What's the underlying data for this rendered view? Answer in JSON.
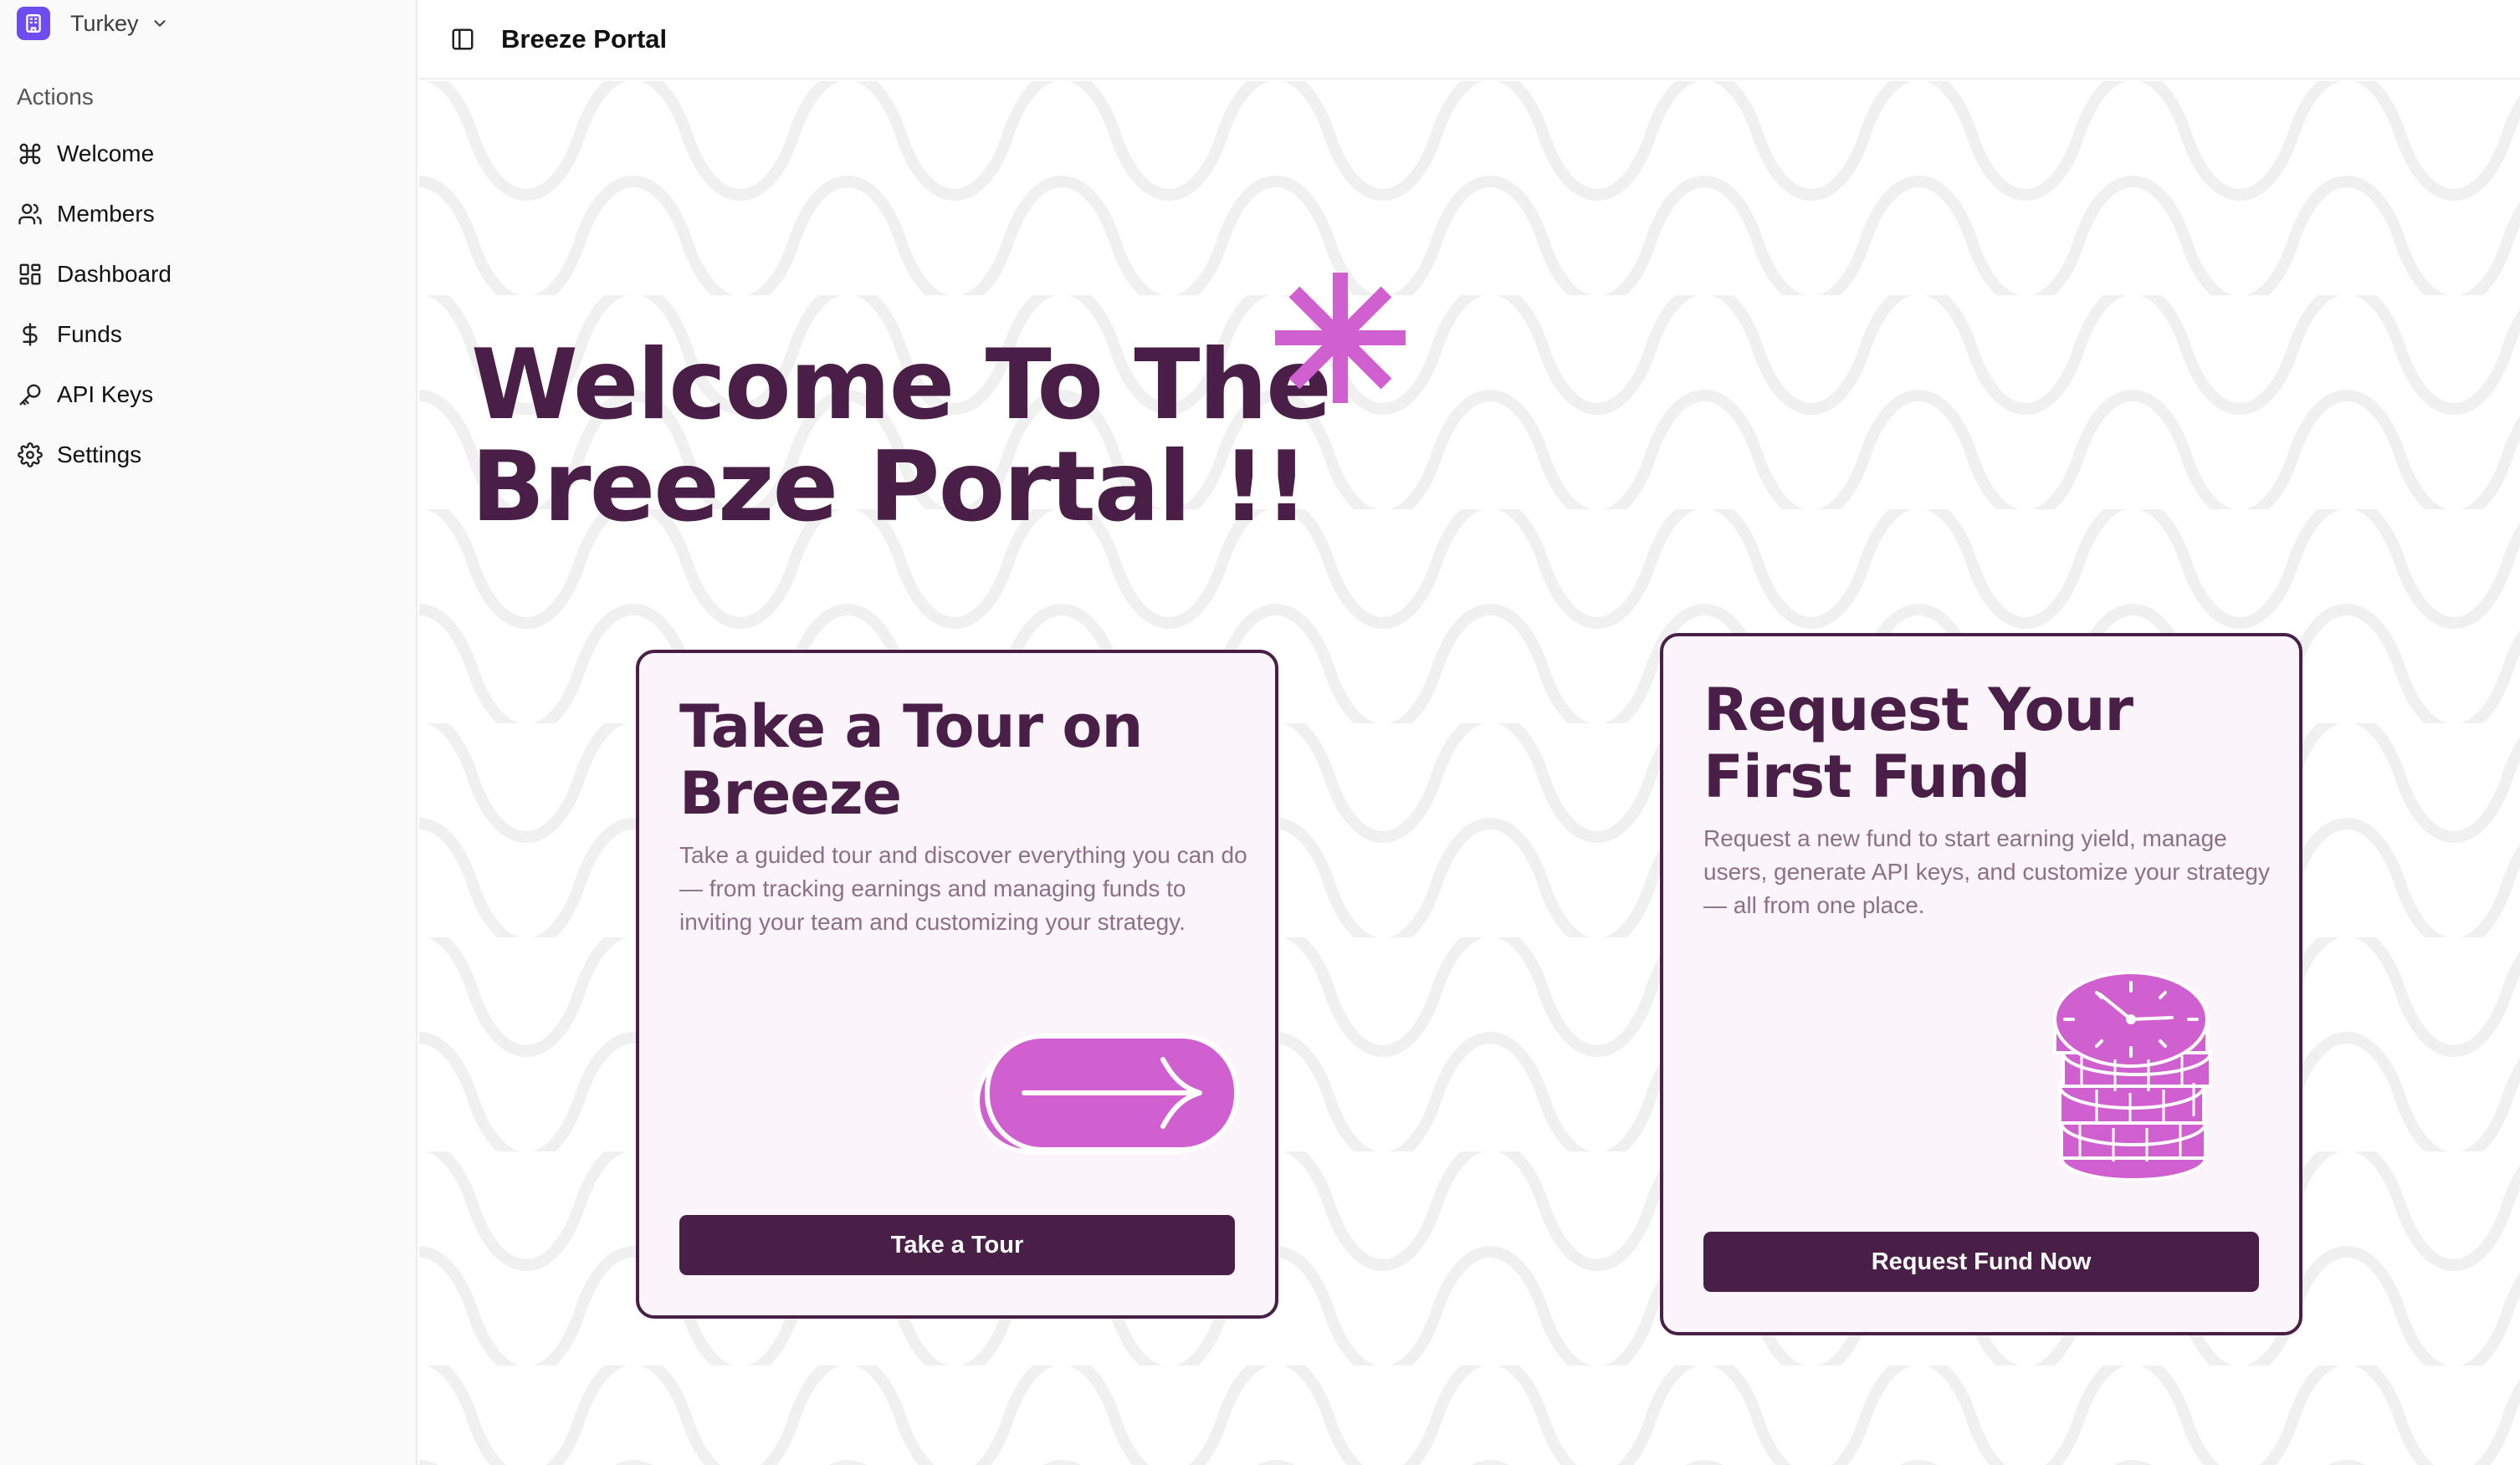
{
  "org": {
    "name": "Turkey",
    "logo_icon": "building-icon"
  },
  "sidebar": {
    "section_label": "Actions",
    "items": [
      {
        "label": "Welcome",
        "icon": "command-icon"
      },
      {
        "label": "Members",
        "icon": "users-icon"
      },
      {
        "label": "Dashboard",
        "icon": "layout-dashboard-icon"
      },
      {
        "label": "Funds",
        "icon": "dollar-icon"
      },
      {
        "label": "API Keys",
        "icon": "key-icon"
      },
      {
        "label": "Settings",
        "icon": "gear-icon"
      }
    ]
  },
  "header": {
    "title": "Breeze Portal"
  },
  "hero": {
    "line1": "Welcome To The",
    "line2": "Breeze Portal !!"
  },
  "cards": [
    {
      "title": "Take a Tour on Breeze",
      "description": "Take a guided tour and discover everything you can do — from tracking earnings and managing funds to inviting your team and customizing your strategy.",
      "button": "Take a Tour",
      "illustration": "arrow-pill-icon"
    },
    {
      "title": "Request Your First Fund",
      "description": "Request a new fund to start earning yield, manage users, generate API keys, and customize your strategy — all from one place.",
      "button": "Request Fund Now",
      "illustration": "clock-coins-icon"
    }
  ],
  "colors": {
    "brand_dark": "#4a1f47",
    "accent_pink": "#d060d0",
    "logo_purple": "#6d4cf0",
    "card_bg": "#fcf4fb",
    "muted_text": "#8b7088"
  }
}
